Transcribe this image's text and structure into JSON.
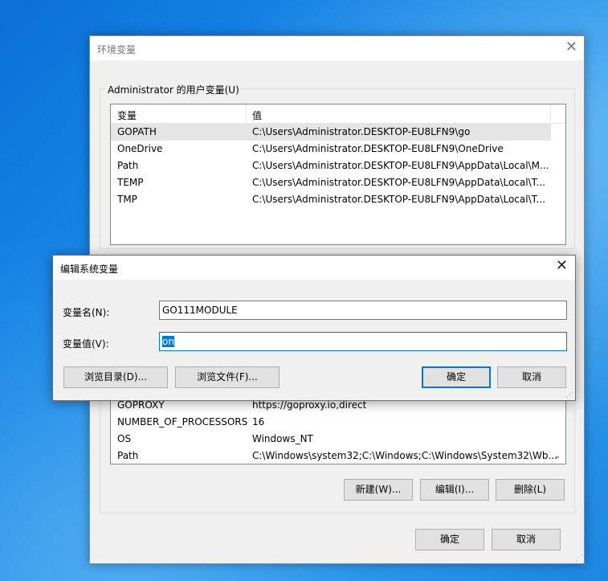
{
  "env_dialog": {
    "title": "环境变量",
    "user_vars": {
      "group_label": "Administrator 的用户变量(U)",
      "columns": [
        "变量",
        "值"
      ],
      "rows": [
        {
          "name": "GOPATH",
          "value": "C:\\Users\\Administrator.DESKTOP-EU8LFN9\\go"
        },
        {
          "name": "OneDrive",
          "value": "C:\\Users\\Administrator.DESKTOP-EU8LFN9\\OneDrive"
        },
        {
          "name": "Path",
          "value": "C:\\Users\\Administrator.DESKTOP-EU8LFN9\\AppData\\Local\\M..."
        },
        {
          "name": "TEMP",
          "value": "C:\\Users\\Administrator.DESKTOP-EU8LFN9\\AppData\\Local\\T..."
        },
        {
          "name": "TMP",
          "value": "C:\\Users\\Administrator.DESKTOP-EU8LFN9\\AppData\\Local\\T..."
        }
      ]
    },
    "system_vars": {
      "rows": [
        {
          "name": "GOPROXY",
          "value": "https://goproxy.io,direct"
        },
        {
          "name": "NUMBER_OF_PROCESSORS",
          "value": "16"
        },
        {
          "name": "OS",
          "value": "Windows_NT"
        },
        {
          "name": "Path",
          "value": "C:\\Windows\\system32;C:\\Windows;C:\\Windows\\System32\\Wb..."
        }
      ],
      "new_label": "新建(W)...",
      "edit_label": "编辑(I)...",
      "delete_label": "删除(L)"
    },
    "ok_label": "确定",
    "cancel_label": "取消"
  },
  "edit_dialog": {
    "title": "编辑系统变量",
    "name_label": "变量名(N):",
    "name_value": "GO111MODULE",
    "value_label": "变量值(V):",
    "value_value": "on",
    "browse_dir_label": "浏览目录(D)...",
    "browse_file_label": "浏览文件(F)...",
    "ok_label": "确定",
    "cancel_label": "取消"
  },
  "icons": {
    "close": "close-icon",
    "scroll_down": "chevron-down-icon",
    "resize_grip": "resize-grip-icon"
  },
  "colors": {
    "accent": "#0078d7",
    "desktop": "#1a8ae8"
  }
}
